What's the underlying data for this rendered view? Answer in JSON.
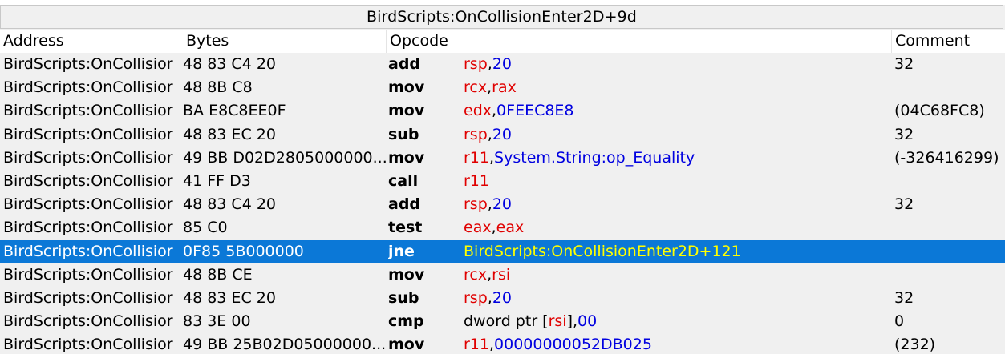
{
  "window": {
    "title": "BirdScripts:OnCollisionEnter2D+9d"
  },
  "header": {
    "address": "Address",
    "bytes": "Bytes",
    "opcode": "Opcode",
    "comment": "Comment"
  },
  "colors": {
    "selection_bg": "#0b78d7",
    "register": "#e00000",
    "number": "#0000e0",
    "selected_operand": "#ffff00"
  },
  "rows": [
    {
      "address": "BirdScripts:OnCollisior",
      "bytes": "48 83 C4 20",
      "mnemonic": "add",
      "operands": [
        {
          "text": "rsp",
          "kind": "reg"
        },
        {
          "text": ",",
          "kind": "plain"
        },
        {
          "text": "20",
          "kind": "num"
        }
      ],
      "comment": "32",
      "selected": false
    },
    {
      "address": "BirdScripts:OnCollisior",
      "bytes": "48 8B C8",
      "mnemonic": "mov",
      "operands": [
        {
          "text": "rcx",
          "kind": "reg"
        },
        {
          "text": ",",
          "kind": "plain"
        },
        {
          "text": "rax",
          "kind": "reg"
        }
      ],
      "comment": "",
      "selected": false
    },
    {
      "address": "BirdScripts:OnCollisior",
      "bytes": "BA E8C8EE0F",
      "mnemonic": "mov",
      "operands": [
        {
          "text": "edx",
          "kind": "reg"
        },
        {
          "text": ",",
          "kind": "plain"
        },
        {
          "text": "0FEEC8E8",
          "kind": "num"
        }
      ],
      "comment": "(04C68FC8)",
      "selected": false
    },
    {
      "address": "BirdScripts:OnCollisior",
      "bytes": "48 83 EC 20",
      "mnemonic": "sub",
      "operands": [
        {
          "text": "rsp",
          "kind": "reg"
        },
        {
          "text": ",",
          "kind": "plain"
        },
        {
          "text": "20",
          "kind": "num"
        }
      ],
      "comment": "32",
      "selected": false
    },
    {
      "address": "BirdScripts:OnCollisior",
      "bytes": "49 BB D02D2805000000...",
      "mnemonic": "mov",
      "operands": [
        {
          "text": "r11",
          "kind": "reg"
        },
        {
          "text": ",",
          "kind": "plain"
        },
        {
          "text": "System.String:op_Equality",
          "kind": "num"
        }
      ],
      "comment": "(-326416299)",
      "selected": false
    },
    {
      "address": "BirdScripts:OnCollisior",
      "bytes": "41 FF D3",
      "mnemonic": "call",
      "operands": [
        {
          "text": "r11",
          "kind": "reg"
        }
      ],
      "comment": "",
      "selected": false
    },
    {
      "address": "BirdScripts:OnCollisior",
      "bytes": "48 83 C4 20",
      "mnemonic": "add",
      "operands": [
        {
          "text": "rsp",
          "kind": "reg"
        },
        {
          "text": ",",
          "kind": "plain"
        },
        {
          "text": "20",
          "kind": "num"
        }
      ],
      "comment": "32",
      "selected": false
    },
    {
      "address": "BirdScripts:OnCollisior",
      "bytes": "85 C0",
      "mnemonic": "test",
      "operands": [
        {
          "text": "eax",
          "kind": "reg"
        },
        {
          "text": ",",
          "kind": "plain"
        },
        {
          "text": "eax",
          "kind": "reg"
        }
      ],
      "comment": "",
      "selected": false
    },
    {
      "address": "BirdScripts:OnCollisior",
      "bytes": "0F85 5B000000",
      "mnemonic": "jne",
      "operands": [
        {
          "text": "BirdScripts:OnCollisionEnter2D+121",
          "kind": "sel"
        }
      ],
      "comment": "",
      "selected": true
    },
    {
      "address": "BirdScripts:OnCollisior",
      "bytes": "48 8B CE",
      "mnemonic": "mov",
      "operands": [
        {
          "text": "rcx",
          "kind": "reg"
        },
        {
          "text": ",",
          "kind": "plain"
        },
        {
          "text": "rsi",
          "kind": "reg"
        }
      ],
      "comment": "",
      "selected": false
    },
    {
      "address": "BirdScripts:OnCollisior",
      "bytes": "48 83 EC 20",
      "mnemonic": "sub",
      "operands": [
        {
          "text": "rsp",
          "kind": "reg"
        },
        {
          "text": ",",
          "kind": "plain"
        },
        {
          "text": "20",
          "kind": "num"
        }
      ],
      "comment": "32",
      "selected": false
    },
    {
      "address": "BirdScripts:OnCollisior",
      "bytes": "83 3E 00",
      "mnemonic": "cmp",
      "operands": [
        {
          "text": "dword ptr [",
          "kind": "plain"
        },
        {
          "text": "rsi",
          "kind": "reg"
        },
        {
          "text": "],",
          "kind": "plain"
        },
        {
          "text": "00",
          "kind": "num"
        }
      ],
      "comment": "0",
      "selected": false
    },
    {
      "address": "BirdScripts:OnCollisior",
      "bytes": "49 BB 25B02D05000000...",
      "mnemonic": "mov",
      "operands": [
        {
          "text": "r11",
          "kind": "reg"
        },
        {
          "text": ",",
          "kind": "plain"
        },
        {
          "text": "00000000052DB025",
          "kind": "num"
        }
      ],
      "comment": "(232)",
      "selected": false
    }
  ]
}
